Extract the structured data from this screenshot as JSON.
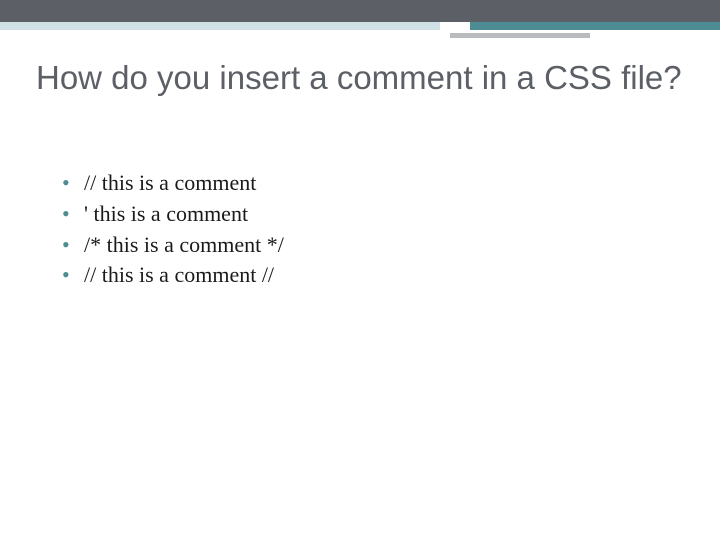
{
  "title": "How do you insert a comment in a CSS file?",
  "options": [
    "// this is a comment",
    "' this is a comment",
    "/* this is a comment */",
    "// this is a comment //"
  ]
}
